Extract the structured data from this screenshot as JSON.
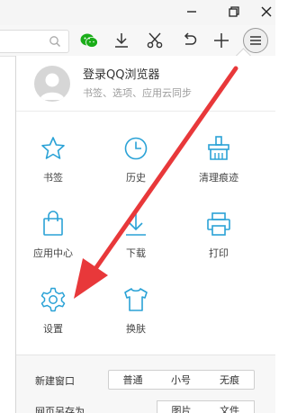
{
  "window": {
    "minimize_icon": "minimize-icon",
    "restore_icon": "restore-icon",
    "close_icon": "close-icon"
  },
  "toolbar": {
    "icons": [
      "search-icon",
      "wechat-icon",
      "download-icon",
      "scissors-icon",
      "undo-icon",
      "new-tab-icon",
      "menu-icon"
    ],
    "wechat_color": "#1aad19"
  },
  "account": {
    "title": "登录QQ浏览器",
    "subtitle": "书签、选项、应用云同步"
  },
  "menu": {
    "items": [
      {
        "label": "书签",
        "icon": "star-icon"
      },
      {
        "label": "历史",
        "icon": "clock-icon"
      },
      {
        "label": "清理痕迹",
        "icon": "broom-icon"
      },
      {
        "label": "应用中心",
        "icon": "bag-icon"
      },
      {
        "label": "下载",
        "icon": "download-icon"
      },
      {
        "label": "打印",
        "icon": "printer-icon"
      },
      {
        "label": "设置",
        "icon": "gear-icon"
      },
      {
        "label": "换肤",
        "icon": "shirt-icon"
      }
    ],
    "icon_color": "#2aa2d6"
  },
  "bottom": {
    "new_window_label": "新建窗口",
    "new_window_options": [
      "普通",
      "小号",
      "无痕"
    ],
    "save_as_label": "网页另存为",
    "save_as_options": [
      "图片",
      "文件"
    ]
  },
  "annotation": {
    "arrow_color": "#e8383a"
  }
}
